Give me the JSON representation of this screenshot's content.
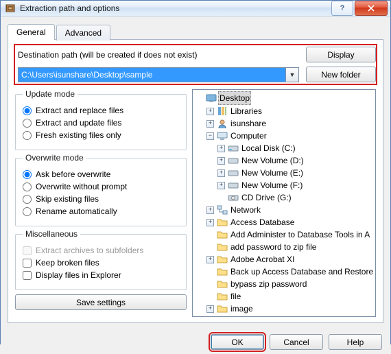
{
  "window": {
    "title": "Extraction path and options"
  },
  "tabs": [
    "General",
    "Advanced"
  ],
  "dest": {
    "label": "Destination path (will be created if does not exist)",
    "value": "C:\\Users\\isunshare\\Desktop\\sample",
    "display_btn": "Display",
    "newfolder_btn": "New folder"
  },
  "update_mode": {
    "legend": "Update mode",
    "options": [
      "Extract and replace files",
      "Extract and update files",
      "Fresh existing files only"
    ],
    "selected": 0
  },
  "overwrite_mode": {
    "legend": "Overwrite mode",
    "options": [
      "Ask before overwrite",
      "Overwrite without prompt",
      "Skip existing files",
      "Rename automatically"
    ],
    "selected": 0
  },
  "misc": {
    "legend": "Miscellaneous",
    "items": [
      {
        "label": "Extract archives to subfolders",
        "checked": false,
        "enabled": false
      },
      {
        "label": "Keep broken files",
        "checked": false,
        "enabled": true
      },
      {
        "label": "Display files in Explorer",
        "checked": false,
        "enabled": true
      }
    ]
  },
  "save_btn": "Save settings",
  "tree": {
    "root": "Desktop",
    "libraries": "Libraries",
    "user": "isunshare",
    "computer": "Computer",
    "drives": [
      "Local Disk (C:)",
      "New Volume (D:)",
      "New Volume (E:)",
      "New Volume (F:)",
      "CD Drive (G:)"
    ],
    "network": "Network",
    "folders": [
      "Access Database",
      "Add Administer to Database Tools in A",
      "add password  to zip file",
      "Adobe Acrobat XI",
      "Back up Access Database and Restore",
      "bypass zip password",
      "file",
      "image"
    ]
  },
  "footer": {
    "ok": "OK",
    "cancel": "Cancel",
    "help": "Help"
  },
  "colors": {
    "highlight_border": "#d42020",
    "selection_bg": "#3399ff"
  }
}
